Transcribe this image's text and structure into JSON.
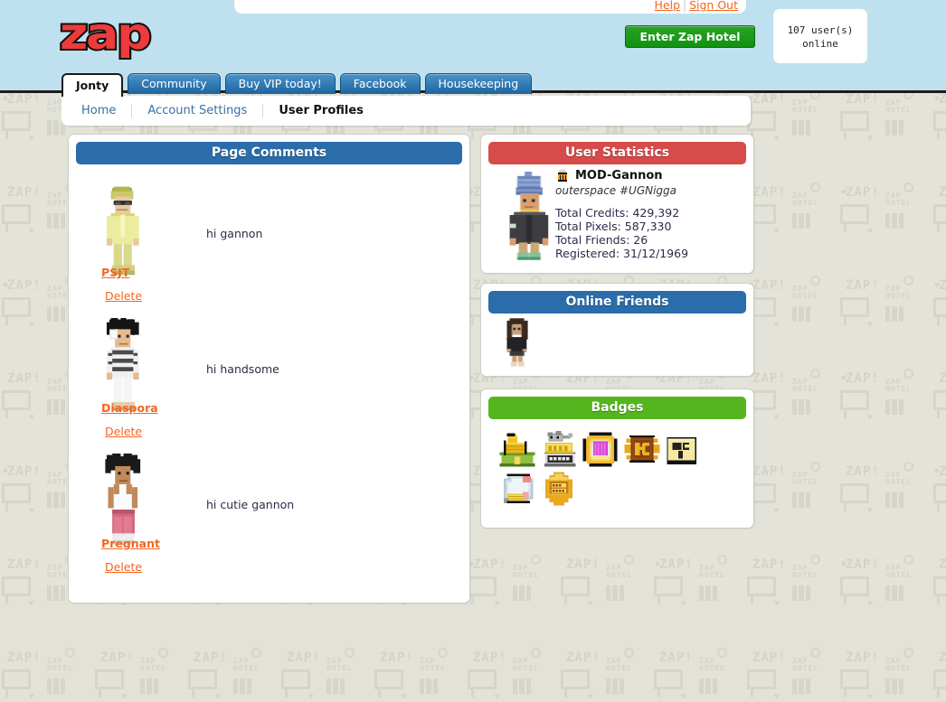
{
  "site": {
    "logo_text": "zap"
  },
  "topbar": {
    "help_label": "Help",
    "separator": "|",
    "signout_label": "Sign Out"
  },
  "header": {
    "enter_button_label": "Enter Zap Hotel",
    "users_online_count": "107 user(s)",
    "users_online_suffix": "online"
  },
  "tabs": [
    {
      "label": "Jonty",
      "active": true
    },
    {
      "label": "Community",
      "active": false
    },
    {
      "label": "Buy VIP today!",
      "active": false
    },
    {
      "label": "Facebook",
      "active": false
    },
    {
      "label": "Housekeeping",
      "active": false
    }
  ],
  "subnav": [
    {
      "label": "Home",
      "current": false
    },
    {
      "label": "Account Settings",
      "current": false
    },
    {
      "label": "User Profiles",
      "current": true
    }
  ],
  "panels": {
    "comments_title": "Page Comments",
    "statistics_title": "User Statistics",
    "friends_title": "Online Friends",
    "badges_title": "Badges"
  },
  "comments": [
    {
      "author": "PSJT",
      "text": "hi gannon",
      "delete_label": "Delete"
    },
    {
      "author": "Diaspora",
      "text": "hi handsome",
      "delete_label": "Delete"
    },
    {
      "author": "Pregnant",
      "text": "hi cutie gannon",
      "delete_label": "Delete"
    }
  ],
  "statistics": {
    "username": "MOD-Gannon",
    "motto": "outerspace #UGNigga",
    "total_credits": "Total Credits: 429,392",
    "total_pixels": "Total Pixels: 587,330",
    "total_friends": "Total Friends: 26",
    "registered": "Registered: 31/12/1969"
  },
  "badges": [
    {
      "name": "thumbs-up-badge"
    },
    {
      "name": "beta-lab-rat-badge"
    },
    {
      "name": "purple-coin-badge"
    },
    {
      "name": "hc-shield-badge"
    },
    {
      "name": "hc-square-badge"
    },
    {
      "name": "pencil-disc-badge"
    },
    {
      "name": "zap-staff-badge"
    }
  ],
  "colors": {
    "header_blue": "#bfe0ef",
    "tab_blue": "#2b6caa",
    "accent_orange": "#f4661f",
    "panel_red": "#d84b4b",
    "panel_green": "#55b51e",
    "button_green": "#12920f"
  },
  "watermark": {
    "zap": "ZAP!",
    "hotel": "ZAP\nHOTEL"
  }
}
